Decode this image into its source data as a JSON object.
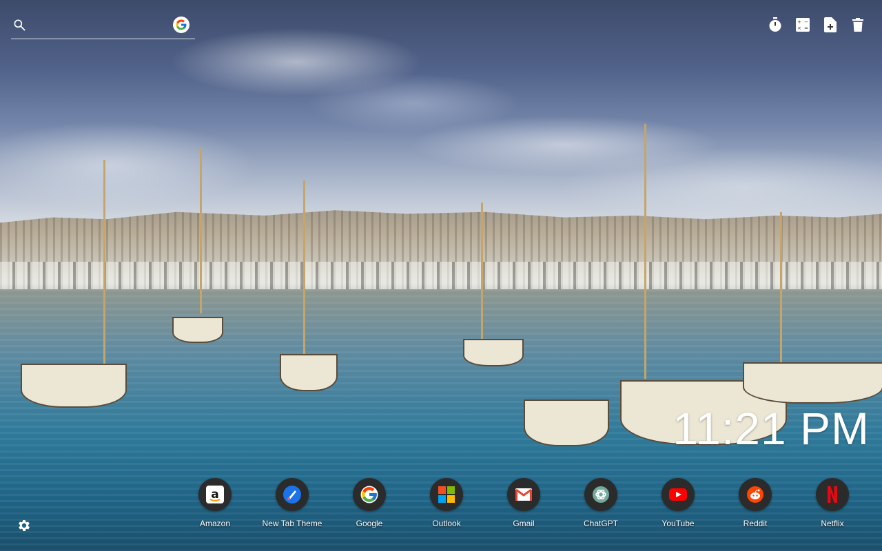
{
  "search": {
    "placeholder": "",
    "value": "",
    "engine_icon": "google-icon"
  },
  "toolbar": {
    "items": [
      {
        "icon": "stopwatch-icon"
      },
      {
        "icon": "calculator-icon"
      },
      {
        "icon": "add-file-icon"
      },
      {
        "icon": "trash-icon"
      }
    ]
  },
  "clock": {
    "time": "11:21 PM"
  },
  "shortcuts": [
    {
      "label": "Amazon",
      "icon": "amazon-icon"
    },
    {
      "label": "New Tab Theme",
      "icon": "new-tab-theme-icon"
    },
    {
      "label": "Google",
      "icon": "google-icon"
    },
    {
      "label": "Outlook",
      "icon": "outlook-icon"
    },
    {
      "label": "Gmail",
      "icon": "gmail-icon"
    },
    {
      "label": "ChatGPT",
      "icon": "chatgpt-icon"
    },
    {
      "label": "YouTube",
      "icon": "youtube-icon"
    },
    {
      "label": "Reddit",
      "icon": "reddit-icon"
    },
    {
      "label": "Netflix",
      "icon": "netflix-icon"
    }
  ],
  "settings": {
    "icon": "gear-icon"
  },
  "colors": {
    "dock_circle": "#2b2b2b",
    "text": "#ffffff"
  }
}
